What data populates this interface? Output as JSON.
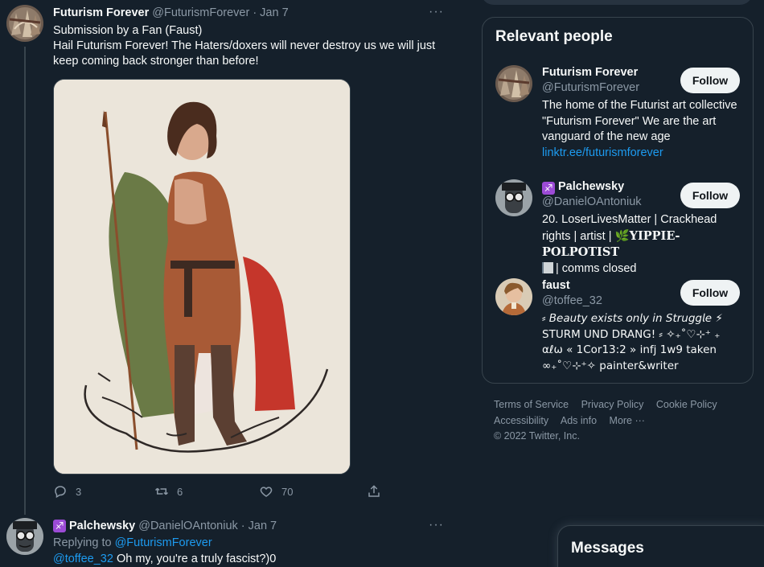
{
  "tweet1": {
    "name": "Futurism Forever",
    "handle": "@FuturismForever",
    "sep": "·",
    "date": "Jan 7",
    "more": "···",
    "line1": "Submission by a Fan (Faust)",
    "line2": "Hail Futurism Forever! The Haters/doxers will never destroy us we will just keep coming back stronger than before!",
    "replies": "3",
    "retweets": "6",
    "likes": "70"
  },
  "tweet2": {
    "name": "Palchewsky",
    "handle": "@DanielOAntoniuk",
    "sep": "·",
    "date": "Jan 7",
    "more": "···",
    "replying_prefix": "Replying to",
    "replying_to": "@FuturismForever",
    "mention": "@toffee_32",
    "text": "Oh my, you're a truly fascist?)0"
  },
  "relevant": {
    "title": "Relevant people",
    "follow_label": "Follow",
    "people": [
      {
        "name": "Futurism Forever",
        "handle": "@FuturismForever",
        "bio": "The home of the Futurist art collective \"Futurism Forever\" We are the art vanguard of the new age",
        "link": "linktr.ee/futurismforever"
      },
      {
        "name_emoji": "♐",
        "name": "Palchewsky",
        "handle": "@DanielOAntoniuk",
        "bio_a": "20. LoserLivesMatter | Crackhead rights | artist |",
        "bio_b": "🌿",
        "bio_c": "𝐘𝐈𝐏𝐏𝐈𝐄-𝐏𝐎𝐋𝐏𝐎𝐓𝐈𝐒𝐓",
        "bio_d": "| comms closed"
      },
      {
        "name": "faust",
        "handle": "@toffee_32",
        "bio_a": "⸗ 𝘉𝘦𝘢𝘶𝘵𝘺 𝘦𝘹𝘪𝘴𝘵𝘴 𝘰𝘯𝘭𝘺 𝘪𝘯 𝘚𝘵𝘳𝘶𝘨𝘨𝘭𝘦 ⚡ STURM UND DRANG! ⸗ ✧₊˚♡︎⊹⁺ ₊ αℓω « 1Cor13:2 » infj 1w9 taken ∞₊˚♡︎⊹⁺✧ painter&writer"
      }
    ]
  },
  "footer": {
    "terms": "Terms of Service",
    "privacy": "Privacy Policy",
    "cookie": "Cookie Policy",
    "accessibility": "Accessibility",
    "ads": "Ads info",
    "more": "More ···",
    "copyright": "© 2022 Twitter, Inc."
  },
  "messages": {
    "title": "Messages"
  },
  "colors": {
    "background": "#15202b",
    "accent": "#1d9bf0",
    "muted": "#8b98a5",
    "border": "#38444d"
  },
  "icons": [
    "reply-icon",
    "retweet-icon",
    "like-icon",
    "share-icon",
    "more-icon"
  ]
}
